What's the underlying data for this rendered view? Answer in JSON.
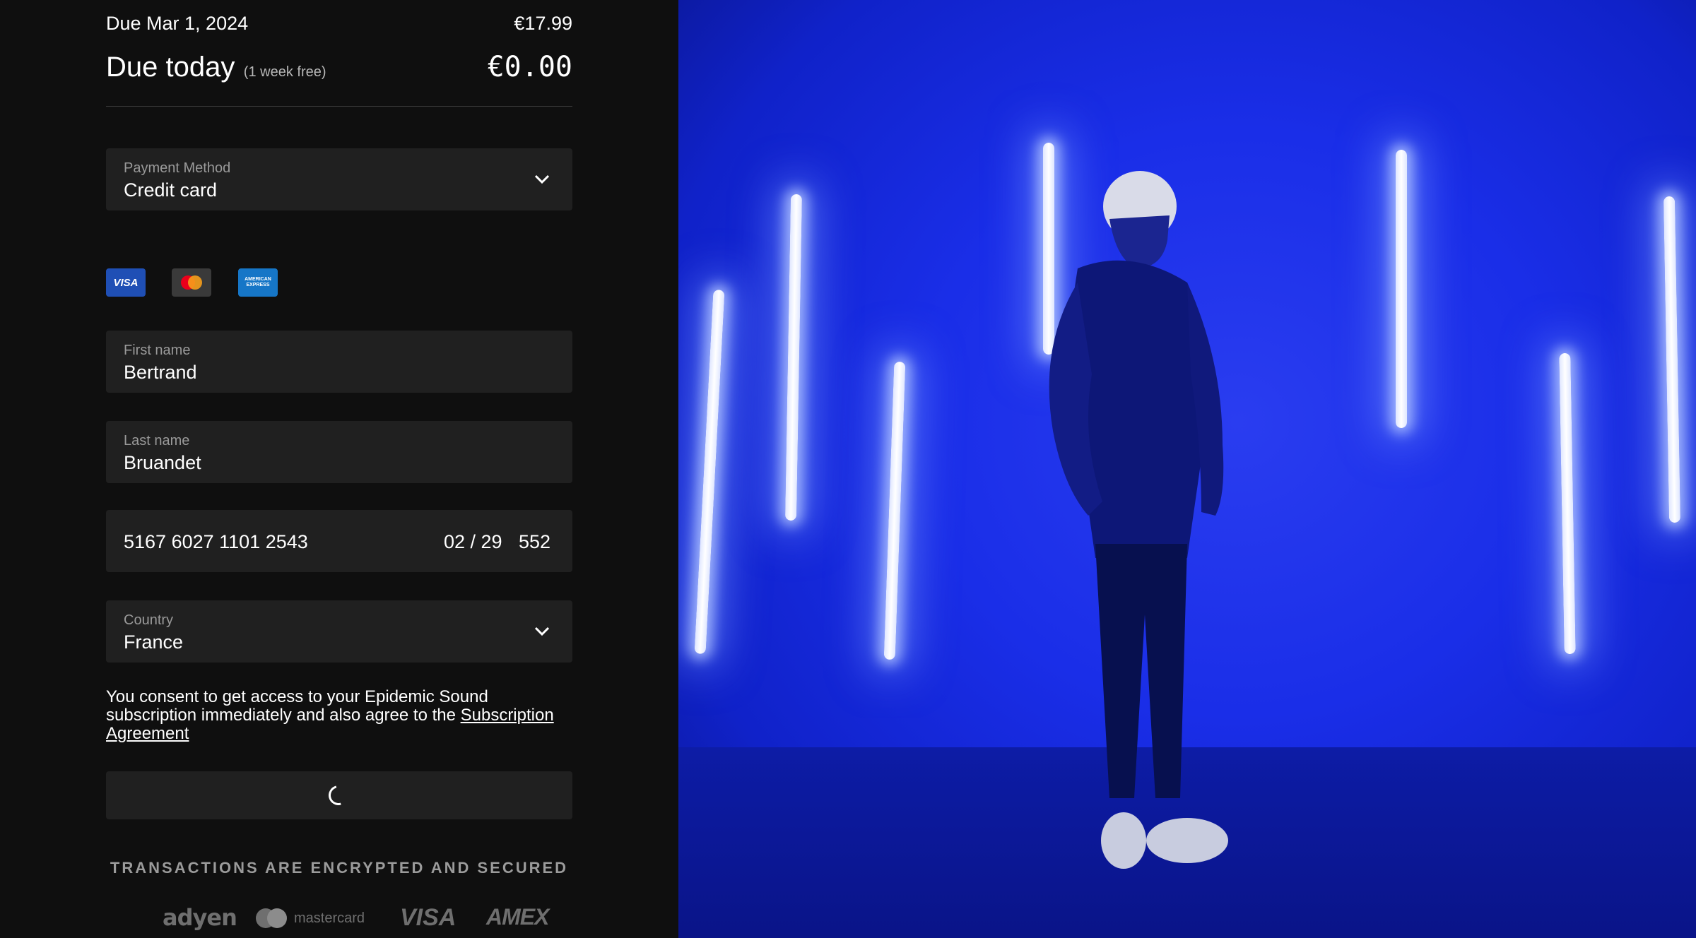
{
  "summary": {
    "due_date_label": "Due Mar 1, 2024",
    "due_date_amount": "€17.99",
    "due_today_label": "Due today",
    "due_today_note": "(1 week free)",
    "due_today_amount": "€0.00"
  },
  "payment_method": {
    "label": "Payment Method",
    "value": "Credit card"
  },
  "card_brands": {
    "visa": "VISA",
    "amex_line1": "AMERICAN",
    "amex_line2": "EXPRESS"
  },
  "first_name": {
    "label": "First name",
    "value": "Bertrand"
  },
  "last_name": {
    "label": "Last name",
    "value": "Bruandet"
  },
  "card": {
    "number": "5167 6027 1101 2543",
    "expiry": "02 / 29",
    "cvc": "552"
  },
  "country": {
    "label": "Country",
    "value": "France"
  },
  "consent": {
    "text": "You consent to get access to your Epidemic Sound subscription immediately and also agree to the ",
    "link": "Subscription Agreement"
  },
  "secure_text": "TRANSACTIONS ARE ENCRYPTED AND SECURED",
  "footer_logos": {
    "adyen": "adyen",
    "mastercard": "mastercard",
    "visa": "VISA",
    "amex": "AMEX"
  },
  "colors": {
    "panel_bg": "#0f0f0f",
    "field_bg": "#202020",
    "photo_blue": "#1a2ee8"
  }
}
